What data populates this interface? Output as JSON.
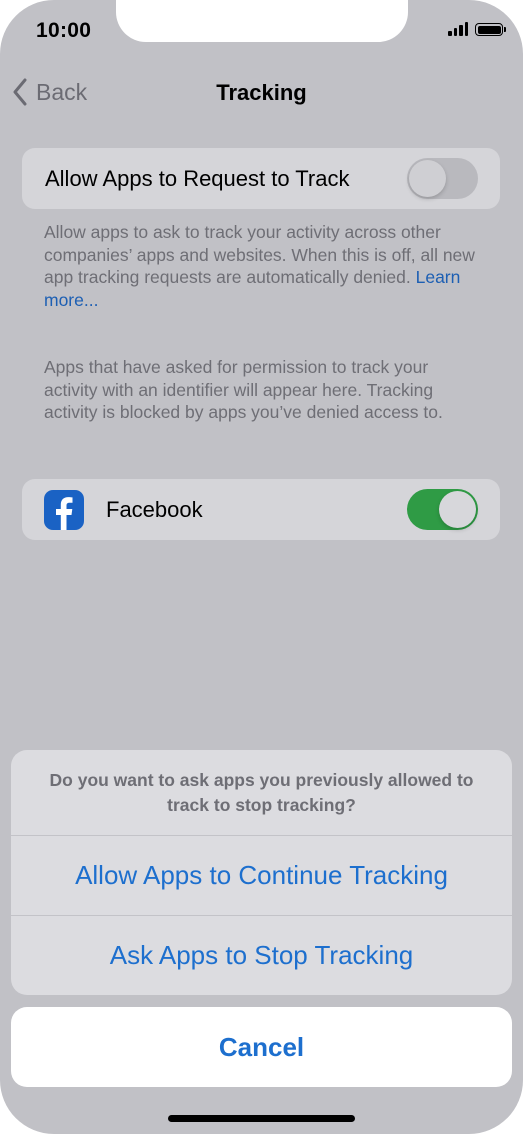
{
  "status": {
    "time": "10:00"
  },
  "nav": {
    "back_label": "Back",
    "title": "Tracking"
  },
  "allow_row": {
    "label": "Allow Apps to Request to Track",
    "toggle": "off"
  },
  "allow_footer": {
    "text": "Allow apps to ask to track your activity across other companies’ apps and websites. When this is off, all new app tracking requests are automatically denied. ",
    "link": "Learn more..."
  },
  "apps_footer": {
    "text": "Apps that have asked for permission to track your activity with an identifier will appear here. Tracking activity is blocked by apps you’ve denied access to."
  },
  "apps": [
    {
      "name": "Facebook",
      "icon": "facebook-icon",
      "toggle": "on"
    }
  ],
  "action_sheet": {
    "message": "Do you want to ask apps you previously allowed to track to stop tracking?",
    "actions": [
      {
        "label": "Allow Apps to Continue Tracking"
      },
      {
        "label": "Ask Apps to Stop Tracking"
      }
    ],
    "cancel_label": "Cancel"
  },
  "colors": {
    "accent": "#1d6fce",
    "toggle_on": "#2f9b45",
    "facebook": "#1a62c4"
  }
}
